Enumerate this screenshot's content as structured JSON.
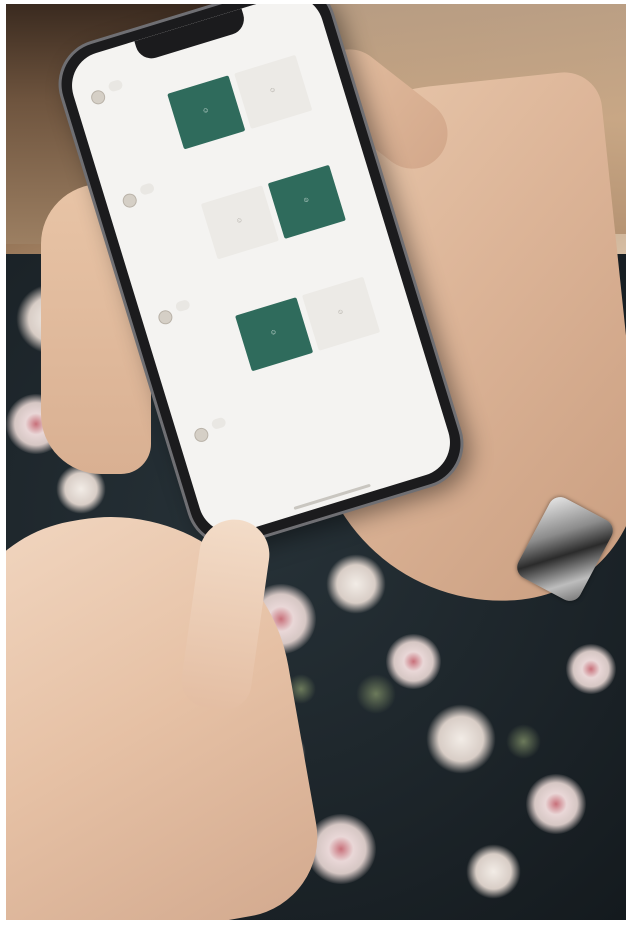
{
  "scene": {
    "description_colors": {
      "dress": "#1c2429",
      "selected_option": "#2f6b5c",
      "screen_bg": "#f4f3f1"
    }
  },
  "chat": {
    "messages": [
      {
        "line1": "",
        "line2": "",
        "options": [
          {
            "label": "",
            "icon": "person-icon",
            "selected": true
          },
          {
            "label": "",
            "icon": "person-icon",
            "selected": false
          }
        ]
      },
      {
        "line1": "",
        "line2": "",
        "options": [
          {
            "label": "",
            "icon": "person-icon",
            "selected": false
          },
          {
            "label": "",
            "icon": "person-icon",
            "selected": true
          }
        ]
      },
      {
        "line1": "",
        "line2": "",
        "options": [
          {
            "label": "",
            "icon": "person-icon",
            "selected": true
          },
          {
            "label": "",
            "icon": "person-icon",
            "selected": false
          }
        ]
      },
      {
        "line1": "",
        "line2": ""
      }
    ],
    "footer": {
      "line1": "",
      "line2": ""
    }
  }
}
